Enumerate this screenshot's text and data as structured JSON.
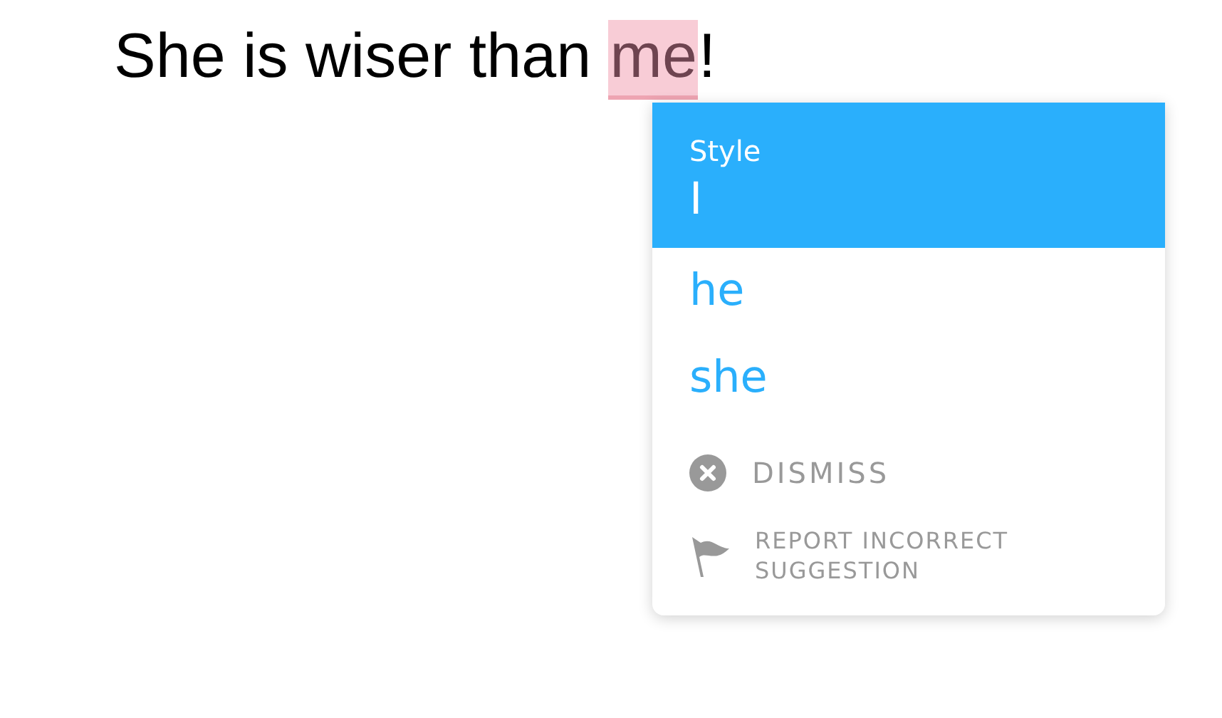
{
  "sentence": {
    "before": "She is wiser than",
    "flagged": "me",
    "after": "!"
  },
  "card": {
    "suggestions": [
      {
        "category": "Style",
        "text": "I",
        "selected": true
      },
      {
        "text": "he",
        "selected": false
      },
      {
        "text": "she",
        "selected": false
      }
    ],
    "actions": [
      {
        "kind": "dismiss",
        "label": "DISMISS"
      },
      {
        "kind": "report",
        "label": "REPORT INCORRECT SUGGESTION"
      }
    ]
  }
}
